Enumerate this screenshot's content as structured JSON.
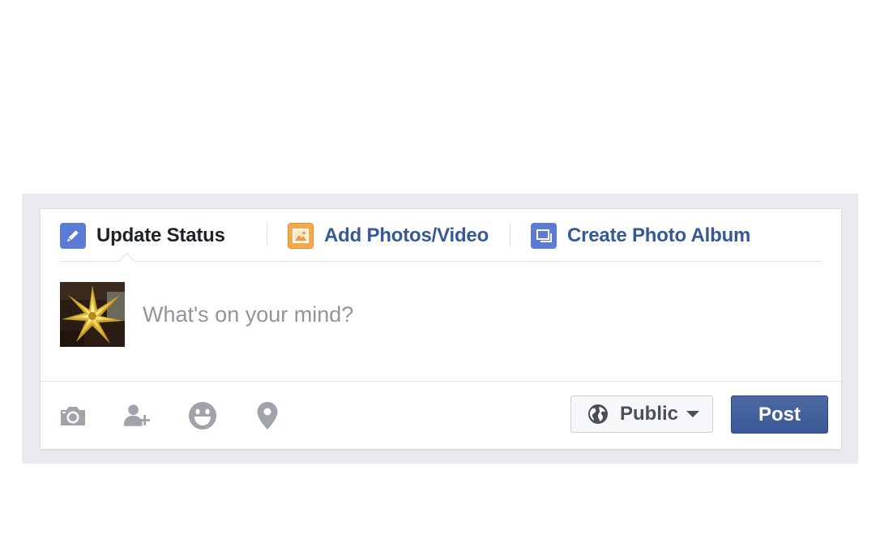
{
  "composer": {
    "tabs": [
      {
        "label": "Update Status",
        "icon": "pencil-icon",
        "active": true
      },
      {
        "label": "Add Photos/Video",
        "icon": "photo-icon",
        "active": false
      },
      {
        "label": "Create Photo Album",
        "icon": "album-icon",
        "active": false
      }
    ],
    "avatar_icon": "profile-photo-gold-bow",
    "placeholder": "What's on your mind?",
    "tools": [
      "camera-icon",
      "tag-friends-icon",
      "feeling-icon",
      "location-icon"
    ],
    "audience": {
      "label": "Public",
      "icon": "globe-icon"
    },
    "post_label": "Post"
  },
  "colors": {
    "link": "#365899",
    "button": "#4267b2",
    "tool_icon": "#a0a3a9",
    "frame": "#e9eaed"
  }
}
